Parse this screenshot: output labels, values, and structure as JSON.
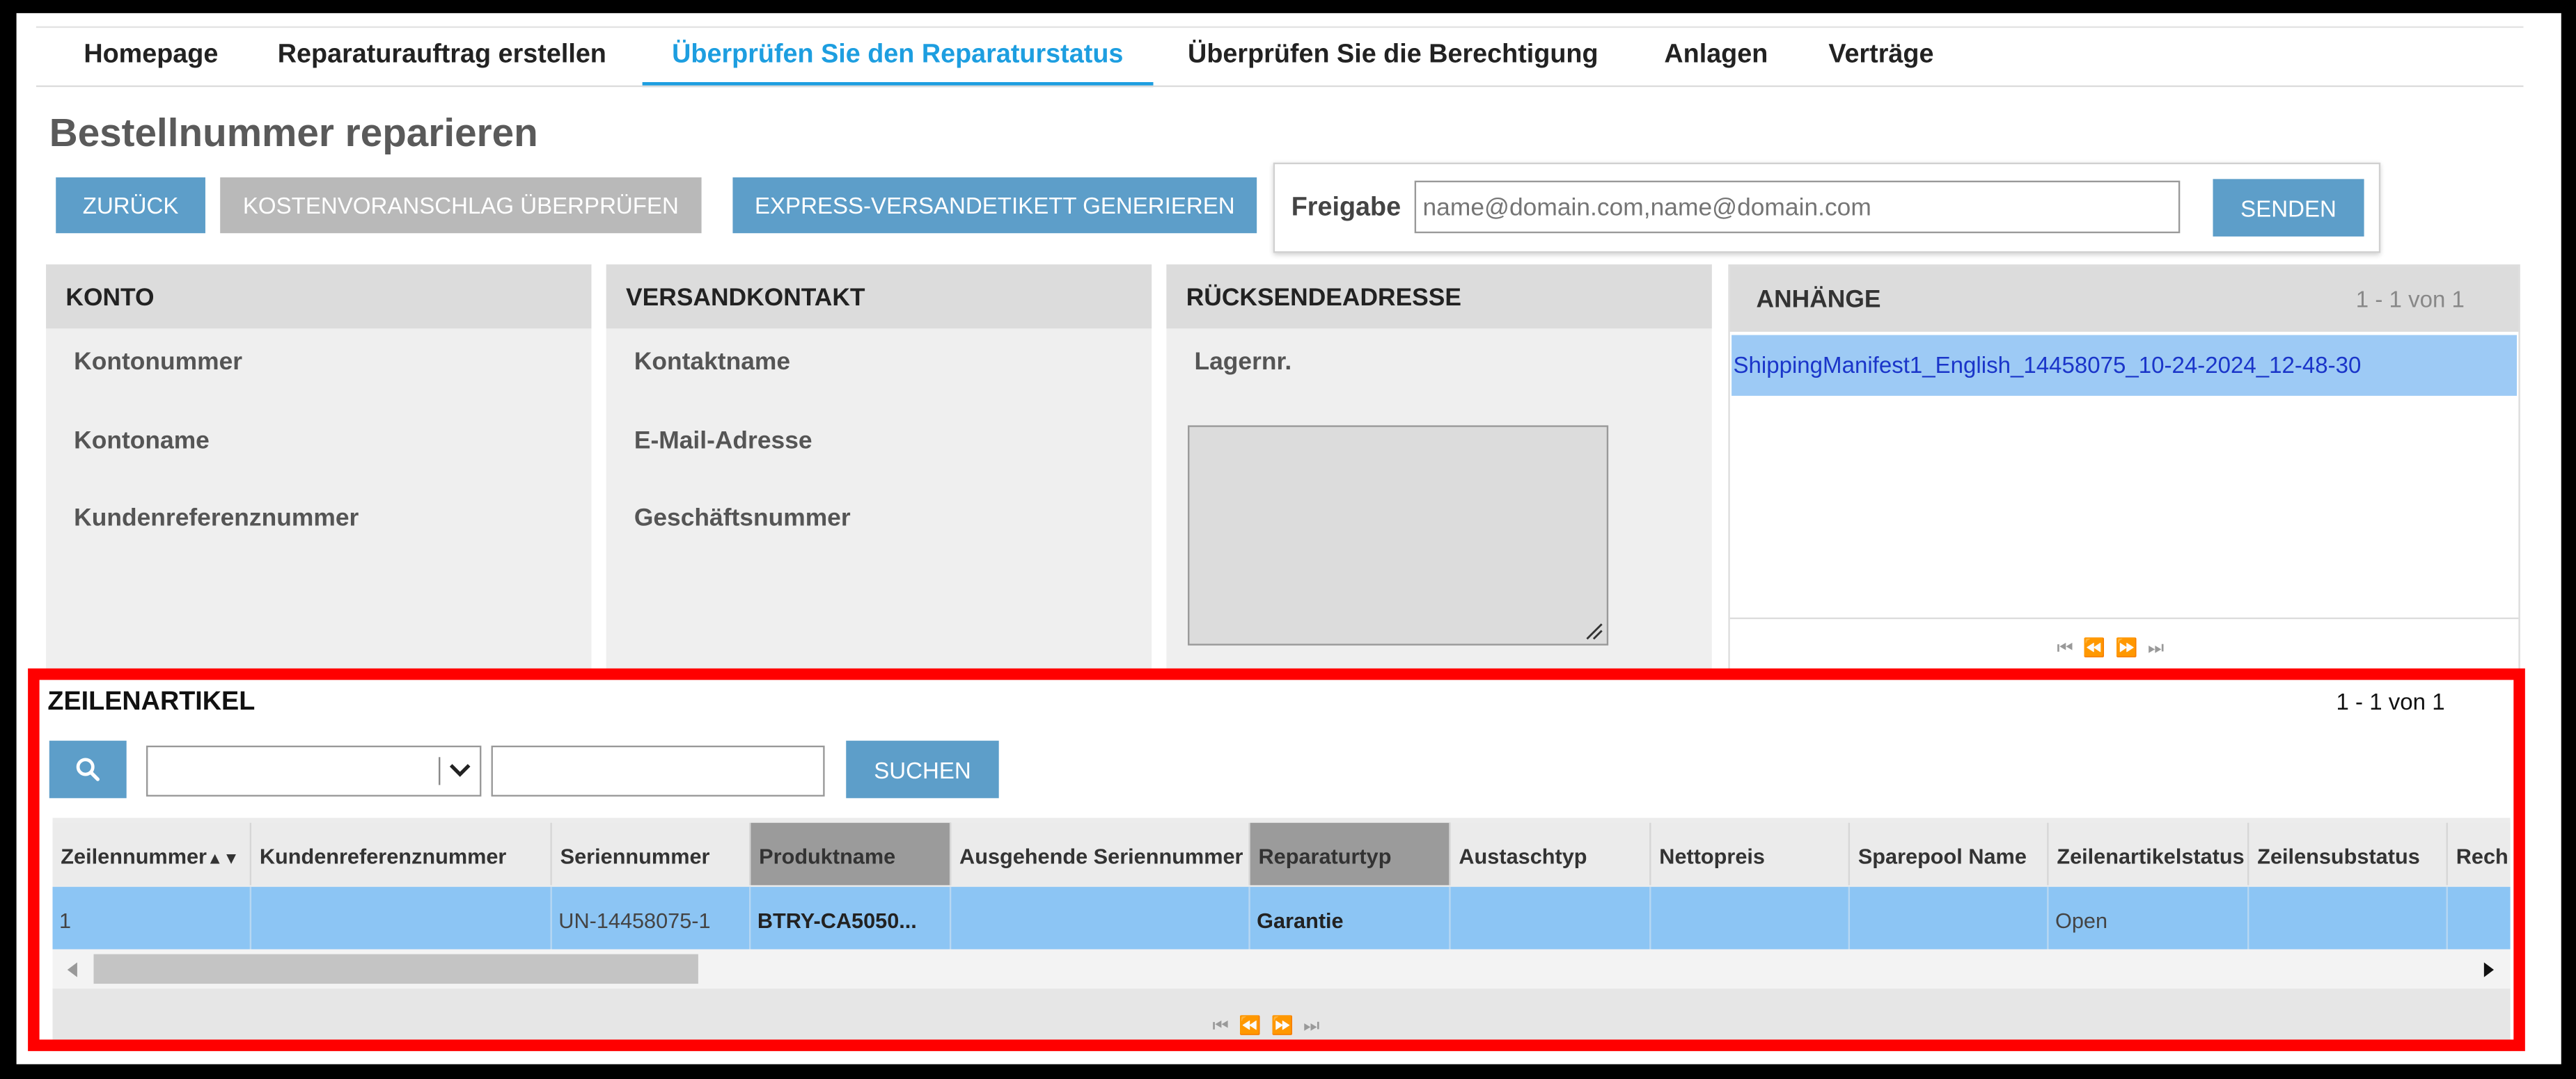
{
  "nav": {
    "items": [
      "Homepage",
      "Reparaturauftrag erstellen",
      "Überprüfen Sie den Reparaturstatus",
      "Überprüfen Sie die Berechtigung",
      "Anlagen",
      "Verträge"
    ],
    "active_index": 2
  },
  "page_title": "Bestellnummer reparieren",
  "toolbar": {
    "back": "ZURÜCK",
    "review_quote": "KOSTENVORANSCHLAG ÜBERPRÜFEN",
    "express_label": "EXPRESS-VERSANDETIKETT GENERIEREN"
  },
  "share": {
    "label": "Freigabe",
    "placeholder": "name@domain.com,name@domain.com",
    "send": "SENDEN"
  },
  "panels": {
    "account": {
      "title": "KONTO",
      "fields": [
        "Kontonummer",
        "Kontoname",
        "Kundenreferenznummer"
      ]
    },
    "shipping_contact": {
      "title": "VERSANDKONTAKT",
      "fields": [
        "Kontaktname",
        "E-Mail-Adresse",
        "Geschäftsnummer"
      ]
    },
    "return_address": {
      "title": "RÜCKSENDEADRESSE",
      "fields": [
        "Lagernr."
      ]
    },
    "attachments": {
      "title": "ANHÄNGE",
      "count": "1 - 1 von 1",
      "files": [
        "ShippingManifest1_English_14458075_10-24-2024_12-48-30"
      ]
    }
  },
  "line_items": {
    "title": "ZEILENARTIKEL",
    "count": "1 - 1 von 1",
    "search_button": "SUCHEN",
    "sort_glyph": "▲▼",
    "columns": [
      "Zeilennummer",
      "Kundenreferenznummer",
      "Seriennummer",
      "Produktname",
      "Ausgehende Seriennummer",
      "Reparaturtyp",
      "Austaschtyp",
      "Nettopreis",
      "Sparepool Name",
      "Zeilenartikelstatus",
      "Zeilensubstatus",
      "Rech"
    ],
    "rows": [
      [
        "1",
        "",
        "UN-14458075-1",
        "BTRY-CA5050...",
        "",
        "Garantie",
        "",
        "",
        "",
        "Open",
        "",
        ""
      ]
    ]
  },
  "icons": {
    "search": "search-icon",
    "dropdown": "chevron-down-icon",
    "pager": [
      "first-page-icon",
      "prev-page-icon",
      "next-page-icon",
      "last-page-icon"
    ],
    "resize": "resize-handle-icon"
  },
  "colors": {
    "accent": "#1d9ee0",
    "button": "#5d9ec9",
    "button_disabled": "#b9b9b9",
    "selected_row": "#8cc5f4",
    "highlight_frame": "#ff0000"
  }
}
